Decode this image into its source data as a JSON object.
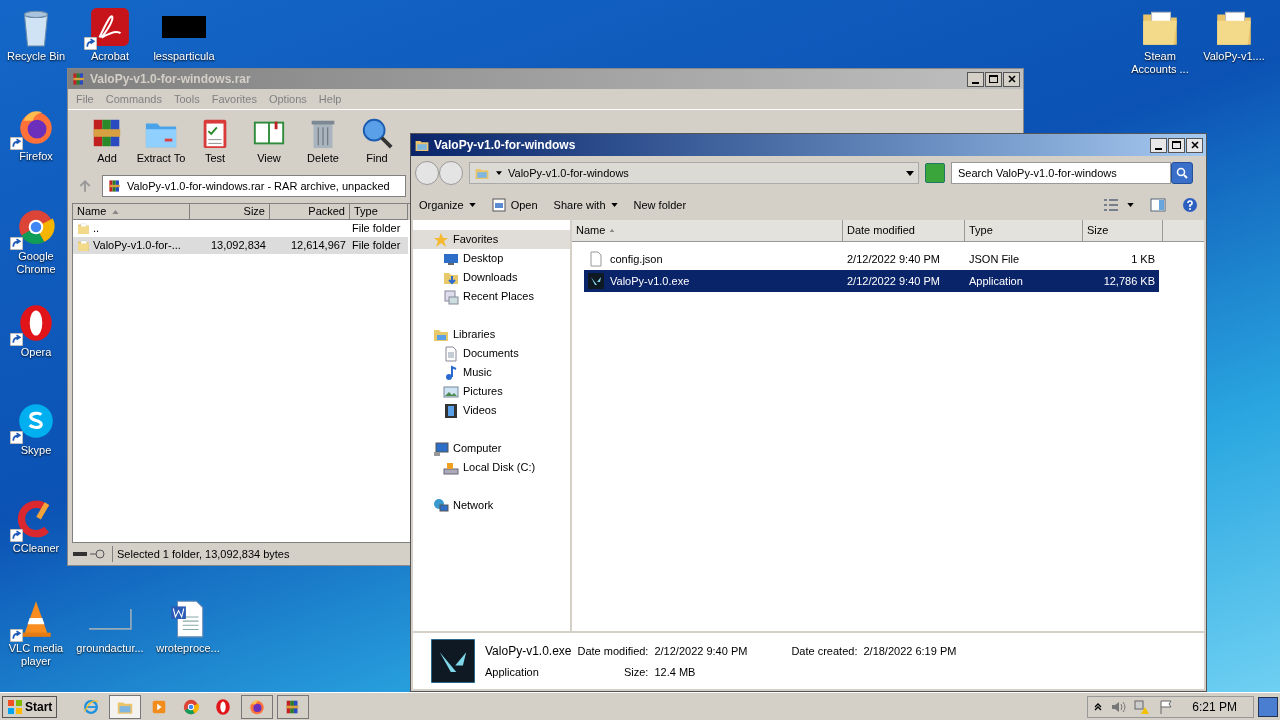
{
  "desktop_icons": [
    {
      "label": "Recycle Bin",
      "kind": "recycle-bin",
      "shortcut": false
    },
    {
      "label": "Firefox",
      "kind": "firefox",
      "shortcut": true
    },
    {
      "label": "Google Chrome",
      "kind": "chrome",
      "shortcut": true
    },
    {
      "label": "Opera",
      "kind": "opera",
      "shortcut": true
    },
    {
      "label": "Skype",
      "kind": "skype",
      "shortcut": true
    },
    {
      "label": "CCleaner",
      "kind": "ccleaner",
      "shortcut": true
    },
    {
      "label": "VLC media player",
      "kind": "vlc",
      "shortcut": true
    },
    {
      "label": "Acrobat",
      "kind": "acrobat",
      "shortcut": true
    },
    {
      "label": "lessparticula",
      "kind": "black",
      "shortcut": false
    },
    {
      "label": "groundactur...",
      "kind": "blank",
      "shortcut": false
    },
    {
      "label": "wroteproce...",
      "kind": "word",
      "shortcut": false
    },
    {
      "label": "Steam Accounts ...",
      "kind": "folder",
      "shortcut": false
    },
    {
      "label": "ValoPy-v1....",
      "kind": "folder",
      "shortcut": false
    }
  ],
  "winrar": {
    "title": "ValoPy-v1.0-for-windows.rar",
    "menu": [
      "File",
      "Commands",
      "Tools",
      "Favorites",
      "Options",
      "Help"
    ],
    "toolbar": [
      {
        "label": "Add",
        "kind": "add"
      },
      {
        "label": "Extract To",
        "kind": "extract"
      },
      {
        "label": "Test",
        "kind": "test"
      },
      {
        "label": "View",
        "kind": "view"
      },
      {
        "label": "Delete",
        "kind": "delete"
      },
      {
        "label": "Find",
        "kind": "find"
      }
    ],
    "address": "ValoPy-v1.0-for-windows.rar - RAR archive, unpacked",
    "columns": [
      "Name",
      "Size",
      "Packed",
      "Type"
    ],
    "rows": [
      {
        "name": "..",
        "size": "",
        "packed": "",
        "type": "File folder",
        "selected": false
      },
      {
        "name": "ValoPy-v1.0-for-...",
        "size": "13,092,834",
        "packed": "12,614,967",
        "type": "File folder",
        "selected": true
      }
    ],
    "status": "Selected 1 folder, 13,092,834 bytes"
  },
  "explorer": {
    "title": "ValoPy-v1.0-for-windows",
    "path": "ValoPy-v1.0-for-windows",
    "search": {
      "placeholder": "Search ValoPy-v1.0-for-windows"
    },
    "toolbar": [
      {
        "label": "Organize",
        "kind": "menu"
      },
      {
        "label": "Open",
        "kind": "open"
      },
      {
        "label": "Share with",
        "kind": "menu"
      },
      {
        "label": "New folder",
        "kind": "plain"
      }
    ],
    "nav": [
      {
        "label": "Favorites",
        "kind": "star",
        "selected": true,
        "children": [
          {
            "label": "Desktop",
            "kind": "desktop",
            "selected": false
          },
          {
            "label": "Downloads",
            "kind": "downloads",
            "selected": false
          },
          {
            "label": "Recent Places",
            "kind": "recent",
            "selected": false
          }
        ]
      },
      {
        "label": "Libraries",
        "kind": "libraries",
        "selected": false,
        "children": [
          {
            "label": "Documents",
            "kind": "documents",
            "selected": false
          },
          {
            "label": "Music",
            "kind": "music",
            "selected": false
          },
          {
            "label": "Pictures",
            "kind": "pictures",
            "selected": false
          },
          {
            "label": "Videos",
            "kind": "videos",
            "selected": false
          }
        ]
      },
      {
        "label": "Computer",
        "kind": "computer",
        "selected": false,
        "children": [
          {
            "label": "Local Disk (C:)",
            "kind": "disk",
            "selected": false
          }
        ]
      },
      {
        "label": "Network",
        "kind": "network",
        "selected": false
      }
    ],
    "columns": [
      "Name",
      "Date modified",
      "Type",
      "Size"
    ],
    "files": [
      {
        "name": "config.json",
        "kind": "doc",
        "date": "2/12/2022 9:40 PM",
        "type": "JSON File",
        "size": "1 KB",
        "selected": false
      },
      {
        "name": "ValoPy-v1.0.exe",
        "kind": "app",
        "date": "2/12/2022 9:40 PM",
        "type": "Application",
        "size": "12,786 KB",
        "selected": true
      }
    ],
    "details": {
      "name": "ValoPy-v1.0.exe",
      "type": "Application",
      "modified_label": "Date modified:",
      "modified": "2/12/2022 9:40 PM",
      "size_label": "Size:",
      "size": "12.4 MB",
      "created_label": "Date created:",
      "created": "2/18/2022 6:19 PM"
    }
  },
  "taskbar": {
    "start": "Start",
    "apps": [
      {
        "kind": "ie",
        "open": false,
        "selected": false
      },
      {
        "kind": "explorer",
        "open": true,
        "selected": true
      },
      {
        "kind": "media",
        "open": false,
        "selected": false
      },
      {
        "kind": "chrome",
        "open": false,
        "selected": false
      },
      {
        "kind": "opera",
        "open": false,
        "selected": false
      },
      {
        "kind": "firefox",
        "open": true,
        "selected": false
      },
      {
        "kind": "winrar",
        "open": true,
        "selected": false
      }
    ],
    "clock": "6:21 PM"
  }
}
